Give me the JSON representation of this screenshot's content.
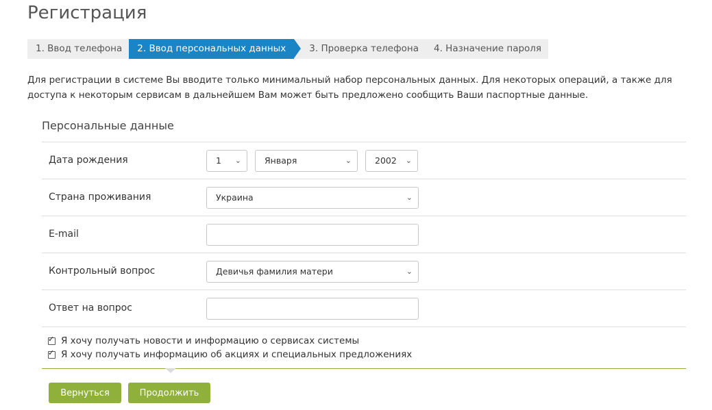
{
  "page": {
    "title": "Регистрация"
  },
  "steps": [
    {
      "label": "1. Ввод телефона",
      "active": false
    },
    {
      "label": "2. Ввод персональных данных",
      "active": true
    },
    {
      "label": "3. Проверка телефона",
      "active": false
    },
    {
      "label": "4. Назначение пароля",
      "active": false
    }
  ],
  "intro": "Для регистрации в системе Вы вводите только минимальный набор персональных данных. Для некоторых операций, а также для доступа к некоторым сервисам в дальнейшем Вам может быть предложено сообщить Ваши паспортные данные.",
  "section": {
    "title": "Персональные данные"
  },
  "form": {
    "birth_date": {
      "label": "Дата рождения",
      "day": "1",
      "month": "Января",
      "year": "2002"
    },
    "country": {
      "label": "Страна проживания",
      "value": "Украина"
    },
    "email": {
      "label": "E-mail",
      "value": "",
      "placeholder": ""
    },
    "question": {
      "label": "Контрольный вопрос",
      "value": "Девичья фамилия матери"
    },
    "answer": {
      "label": "Ответ на вопрос",
      "value": "",
      "placeholder": ""
    }
  },
  "checkboxes": [
    {
      "label": "Я хочу получать новости и информацию о сервисах системы",
      "checked": true
    },
    {
      "label": "Я хочу получать информацию об акциях и специальных предложениях",
      "checked": true
    }
  ],
  "buttons": {
    "back": "Вернуться",
    "next": "Продолжить"
  },
  "icons": {
    "dropdown": "chevron-down-icon",
    "check": "checkmark-icon"
  },
  "colors": {
    "accent_blue": "#1a84c4",
    "button_green": "#8fb13b",
    "divider_green": "#8fb13b"
  }
}
